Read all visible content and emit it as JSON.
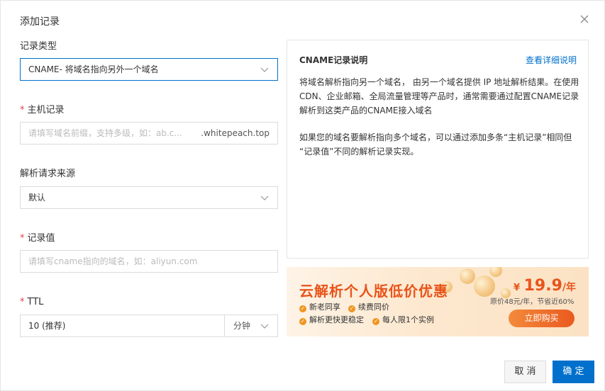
{
  "dialog": {
    "title": "添加记录"
  },
  "form": {
    "record_type": {
      "label": "记录类型",
      "value": "CNAME- 将域名指向另外一个域名"
    },
    "host": {
      "label": "主机记录",
      "placeholder": "请填写域名前缀，支持多级，如：ab.c...",
      "suffix": ".whitepeach.top"
    },
    "source": {
      "label": "解析请求来源",
      "value": "默认"
    },
    "value": {
      "label": "记录值",
      "placeholder": "请填写cname指向的域名，如：aliyun.com"
    },
    "ttl": {
      "label": "TTL",
      "value": "10 (推荐)",
      "unit": "分钟"
    },
    "required_mark": "*"
  },
  "help": {
    "title": "CNAME记录说明",
    "link": "查看详细说明",
    "para1_lines": [
      "将域名解析指向另一个域名， 由另一个域名提供 IP 地址解析结果。在使用",
      "CDN、企业邮箱、全局流量管理等产品时，通常需要通过配置CNAME记录",
      "解析到这类产品的CNAME接入域名"
    ],
    "para2_lines": [
      "如果您的域名要解析指向多个域名，可以通过添加多条“主机记录”相同但",
      "“记录值”不同的解析记录实现。"
    ]
  },
  "promo": {
    "title": "云解析个人版低价优惠",
    "features": [
      "新老同享",
      "续费同价",
      "解析更快更稳定",
      "每人限1个实例"
    ],
    "price_currency": "¥",
    "price": "19.9",
    "price_unit": "/年",
    "original": "原价48元/年，节省近60%",
    "buy_label": "立即购买",
    "accent_color": "#e8541a"
  },
  "footer": {
    "cancel_label": "取 消",
    "ok_label": "确 定"
  },
  "colors": {
    "primary": "#0070cc",
    "required": "#e5414a"
  }
}
